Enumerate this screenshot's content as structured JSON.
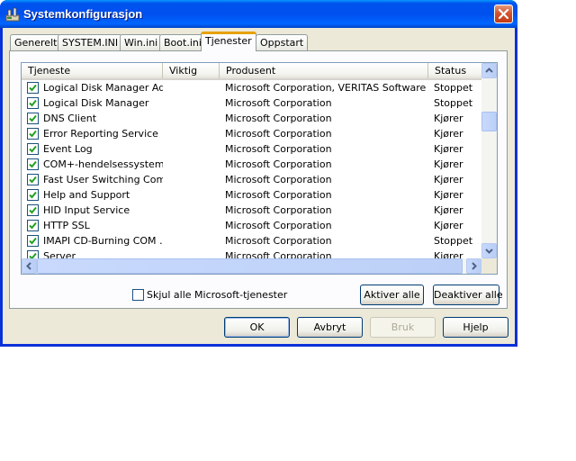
{
  "window": {
    "title": "Systemkonfigurasjon"
  },
  "tabs": [
    {
      "label": "Generelt"
    },
    {
      "label": "SYSTEM.INI"
    },
    {
      "label": "Win.ini"
    },
    {
      "label": "Boot.ini"
    },
    {
      "label": "Tjenester",
      "active": true
    },
    {
      "label": "Oppstart"
    }
  ],
  "services": {
    "columns": [
      "Tjeneste",
      "Viktig",
      "Produsent",
      "Status"
    ],
    "rows": [
      {
        "name": "Logical Disk Manager Ad…",
        "checked": true,
        "important": "",
        "vendor": "Microsoft Corporation, VERITAS Software",
        "status": "Stoppet"
      },
      {
        "name": "Logical Disk Manager",
        "checked": true,
        "important": "",
        "vendor": "Microsoft Corporation",
        "status": "Stoppet"
      },
      {
        "name": "DNS Client",
        "checked": true,
        "important": "",
        "vendor": "Microsoft Corporation",
        "status": "Kjører"
      },
      {
        "name": "Error Reporting Service",
        "checked": true,
        "important": "",
        "vendor": "Microsoft Corporation",
        "status": "Kjører"
      },
      {
        "name": "Event Log",
        "checked": true,
        "important": "",
        "vendor": "Microsoft Corporation",
        "status": "Kjører"
      },
      {
        "name": "COM+-hendelsessystem",
        "checked": true,
        "important": "",
        "vendor": "Microsoft Corporation",
        "status": "Kjører"
      },
      {
        "name": "Fast User Switching Com…",
        "checked": true,
        "important": "",
        "vendor": "Microsoft Corporation",
        "status": "Kjører"
      },
      {
        "name": "Help and Support",
        "checked": true,
        "important": "",
        "vendor": "Microsoft Corporation",
        "status": "Kjører"
      },
      {
        "name": "HID Input Service",
        "checked": true,
        "important": "",
        "vendor": "Microsoft Corporation",
        "status": "Kjører"
      },
      {
        "name": "HTTP SSL",
        "checked": true,
        "important": "",
        "vendor": "Microsoft Corporation",
        "status": "Kjører"
      },
      {
        "name": "IMAPI CD-Burning COM …",
        "checked": true,
        "important": "",
        "vendor": "Microsoft Corporation",
        "status": "Stoppet"
      },
      {
        "name": "Server",
        "checked": true,
        "important": "",
        "vendor": "Microsoft Corporation",
        "status": "Kjører"
      }
    ]
  },
  "hide_ms": {
    "label": "Skjul alle Microsoft-tjenester",
    "checked": false
  },
  "buttons": {
    "enable_all": "Aktiver alle",
    "disable_all": "Deaktiver alle",
    "ok": "OK",
    "cancel": "Avbryt",
    "apply": "Bruk",
    "help": "Hjelp"
  },
  "icons": {
    "app": "system-config-icon",
    "close": "close-icon",
    "scroll_up": "arrow-up-icon",
    "scroll_down": "arrow-down-icon",
    "scroll_left": "arrow-left-icon",
    "scroll_right": "arrow-right-icon",
    "check": "checkmark-icon"
  },
  "colors": {
    "titlebar": "#0054e3",
    "dialog_bg": "#ece9d8",
    "active_tab_accent": "#ffc83c",
    "checkbox_check": "#21a121"
  }
}
